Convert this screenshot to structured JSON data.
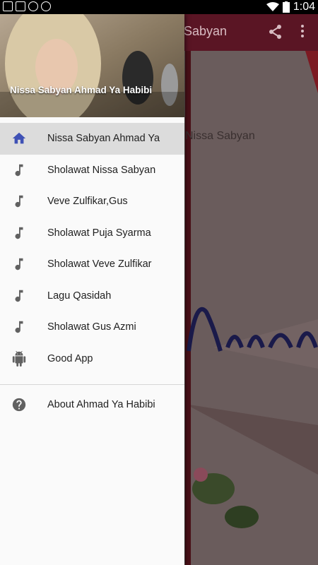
{
  "status_bar": {
    "time": "1:04"
  },
  "background_app": {
    "title": "a Sabyan",
    "content_text": "Nissa Sabyan"
  },
  "drawer": {
    "header_title": "Nissa Sabyan Ahmad Ya Habibi",
    "items": [
      {
        "label": "Nissa Sabyan Ahmad Ya",
        "icon": "home-icon",
        "active": true
      },
      {
        "label": "Sholawat Nissa Sabyan",
        "icon": "music-note-icon"
      },
      {
        "label": "Veve Zulfikar,Gus",
        "icon": "music-note-icon"
      },
      {
        "label": "Sholawat Puja Syarma",
        "icon": "music-note-icon"
      },
      {
        "label": "Sholawat Veve Zulfikar",
        "icon": "music-note-icon"
      },
      {
        "label": "Lagu Qasidah",
        "icon": "music-note-icon"
      },
      {
        "label": "Sholawat Gus Azmi",
        "icon": "music-note-icon"
      },
      {
        "label": "Good App",
        "icon": "android-icon"
      }
    ],
    "footer_items": [
      {
        "label": "About Ahmad Ya Habibi",
        "icon": "help-icon"
      }
    ]
  },
  "colors": {
    "accent": "#3f51b5",
    "icon_grey": "#616161",
    "appbar": "#5a1524"
  }
}
